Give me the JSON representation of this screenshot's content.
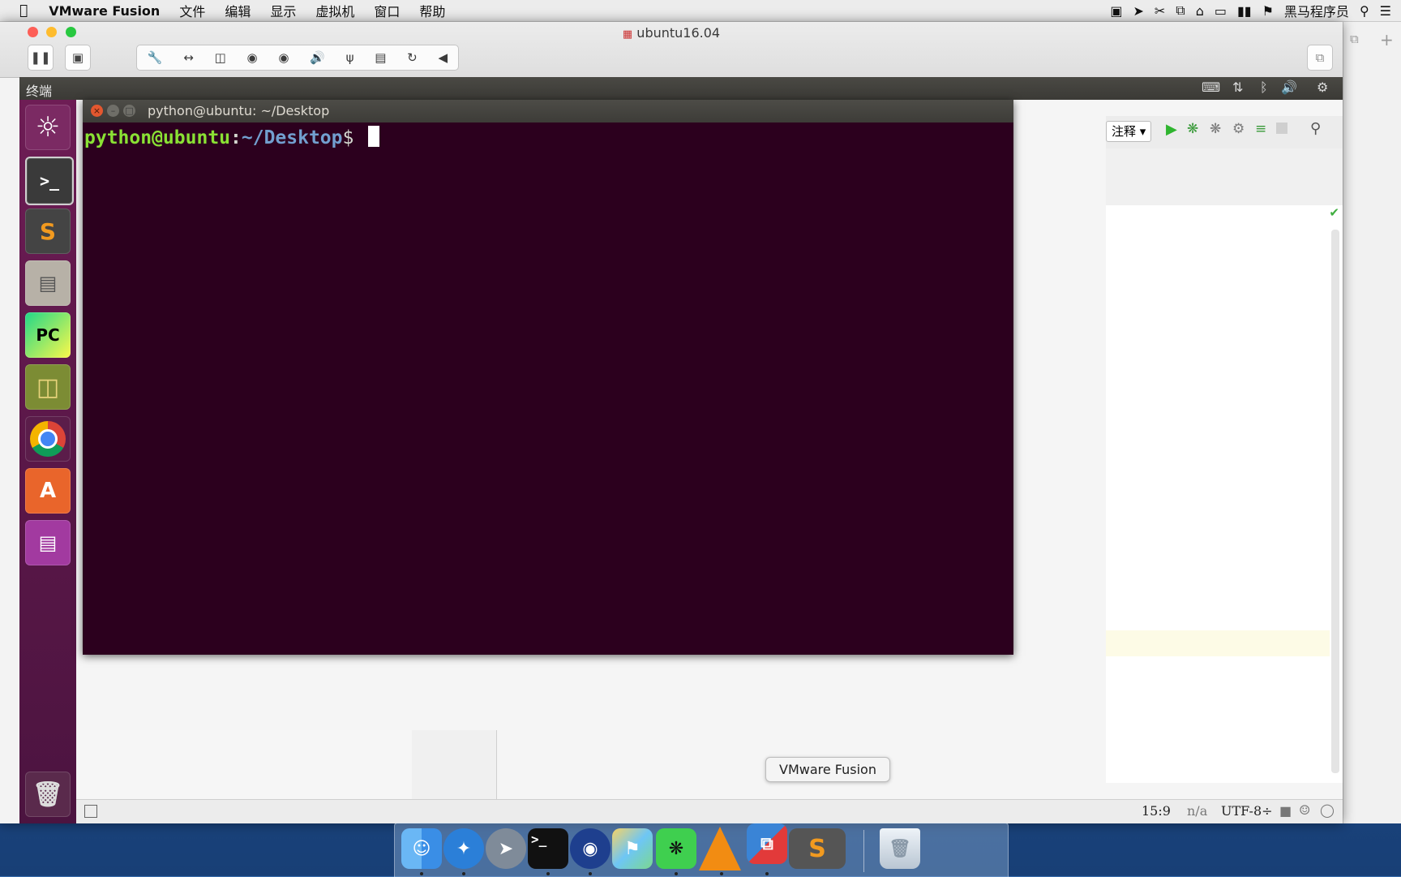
{
  "menubar": {
    "app_name": "VMware Fusion",
    "items": [
      "文件",
      "编辑",
      "显示",
      "虚拟机",
      "窗口",
      "帮助"
    ],
    "user_name": "黑马程序员"
  },
  "window": {
    "title": "ubuntu16.04"
  },
  "guest": {
    "panel_title": "终端",
    "terminal": {
      "title": "python@ubuntu: ~/Desktop",
      "prompt_user": "python@ubuntu",
      "prompt_sep": ":",
      "prompt_path": "~/Desktop",
      "prompt_symbol": "$"
    },
    "ide": {
      "comment_dropdown": "注释",
      "status_position": "15:9",
      "status_na": "n/a",
      "status_encoding": "UTF-8÷"
    }
  },
  "dock": {
    "tooltip": "VMware Fusion"
  },
  "colors": {
    "terminal_bg": "#2c001e",
    "prompt_user": "#8ae234",
    "prompt_path": "#729fcf",
    "launcher": "#5a1748"
  }
}
